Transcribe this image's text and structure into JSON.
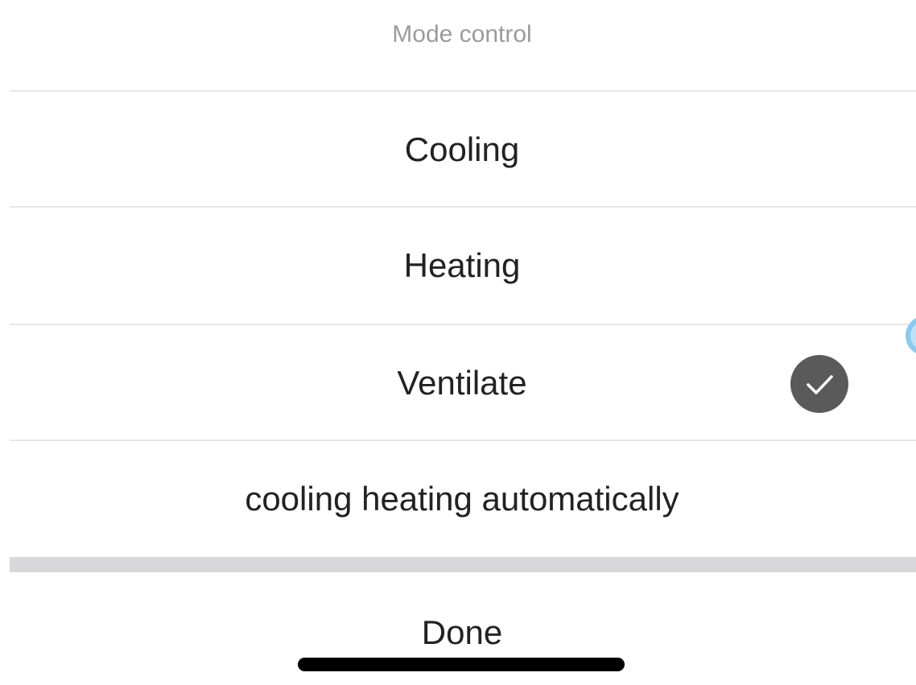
{
  "sheet": {
    "title": "Mode control",
    "options": [
      {
        "label": "Cooling",
        "selected": false
      },
      {
        "label": "Heating",
        "selected": false
      },
      {
        "label": "Ventilate",
        "selected": true
      },
      {
        "label": "cooling heating automatically",
        "selected": false
      }
    ],
    "done_label": "Done"
  },
  "icons": {
    "selected_check": "checkmark-circle-icon"
  },
  "colors": {
    "title_text": "#9b9b9b",
    "option_text": "#222222",
    "check_fill": "#5a5a5a",
    "divider": "#e6e6e6",
    "gap_band": "#d8d8dc"
  }
}
